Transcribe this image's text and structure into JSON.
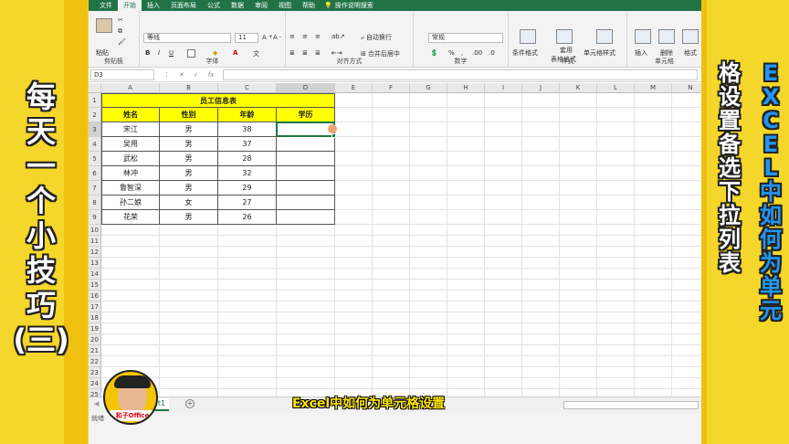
{
  "left_title": [
    "每",
    "天",
    "一",
    "个",
    "小",
    "技",
    "巧",
    "(三)"
  ],
  "right_title_1": [
    "E",
    "X",
    "C",
    "E",
    "L",
    "中",
    "如",
    "何",
    "为",
    "单",
    "元"
  ],
  "right_title_2": [
    "格",
    "设",
    "置",
    "备",
    "选",
    "下",
    "拉",
    "列",
    "表"
  ],
  "ribbon_tabs": [
    "文件",
    "开始",
    "插入",
    "页面布局",
    "公式",
    "数据",
    "审阅",
    "视图",
    "帮助"
  ],
  "active_tab": "开始",
  "help_search": "操作说明搜索",
  "ribbon": {
    "paste": "粘贴",
    "clipboard": "剪贴板",
    "font_name": "等线",
    "font_size": "11",
    "font_group": "字体",
    "wrap": "自动换行",
    "merge": "合并后居中",
    "align_group": "对齐方式",
    "number_format": "常规",
    "number_group": "数字",
    "cond_format": "条件格式",
    "table_format_1": "套用",
    "table_format_2": "表格格式",
    "cell_style": "单元格样式",
    "style_group": "样式",
    "insert": "插入",
    "delete": "删除",
    "format": "格式",
    "cells_group": "单元格"
  },
  "name_box": "D3",
  "fx": "fx",
  "columns": [
    "A",
    "B",
    "C",
    "D",
    "E",
    "F",
    "G",
    "H",
    "I",
    "J",
    "K",
    "L",
    "M",
    "N"
  ],
  "rows": [
    "1",
    "2",
    "3",
    "4",
    "5",
    "6",
    "7",
    "8",
    "9",
    "10",
    "11",
    "12",
    "13",
    "14",
    "15",
    "16",
    "17",
    "18",
    "19",
    "20",
    "21",
    "22",
    "23",
    "24",
    "25"
  ],
  "table": {
    "title": "员工信息表",
    "headers": [
      "姓名",
      "性别",
      "年龄",
      "学历"
    ],
    "data": [
      [
        "宋江",
        "男",
        "38",
        ""
      ],
      [
        "吴用",
        "男",
        "37",
        ""
      ],
      [
        "武松",
        "男",
        "28",
        ""
      ],
      [
        "林冲",
        "男",
        "32",
        ""
      ],
      [
        "鲁智深",
        "男",
        "29",
        ""
      ],
      [
        "孙二娘",
        "女",
        "27",
        ""
      ],
      [
        "花荣",
        "男",
        "26",
        ""
      ]
    ]
  },
  "sheet_tab": "Sheet1",
  "status": "就绪",
  "subtitle": "Excel中如何为单元格设置",
  "logo_text": "和子Office",
  "colors": {
    "excel_green": "#217346",
    "header_yellow": "#ffff00",
    "frame_yellow": "#f5d62a"
  }
}
